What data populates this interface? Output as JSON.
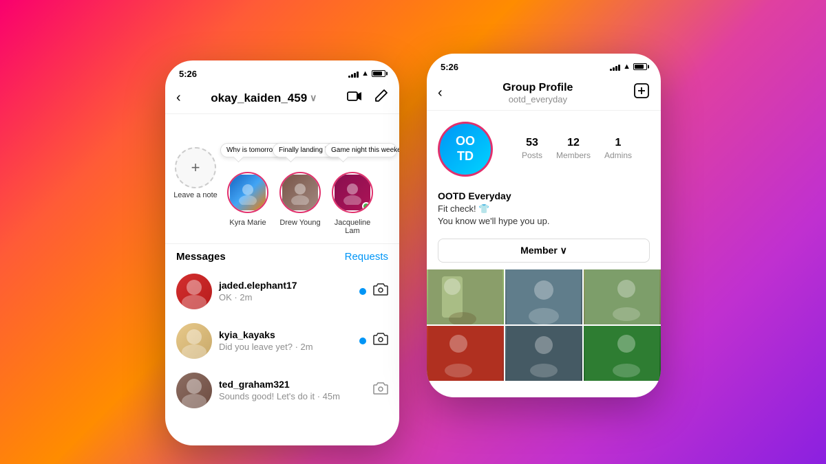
{
  "background": {
    "gradient": "linear-gradient(135deg, #f9006e, #ff5b37, #ff8c00, #e040a0, #c030d0, #8b20e0)"
  },
  "phone_left": {
    "status_bar": {
      "time": "5:26"
    },
    "header": {
      "back_label": "<",
      "username": "okay_kaiden_459",
      "chevron": "∨"
    },
    "stories": {
      "items": [
        {
          "name": "Leave a note",
          "type": "add",
          "label": "Leave a note"
        },
        {
          "name": "Kyra Marie",
          "note": "Why is tomorrow Monday!?😩",
          "label": "Kyra Marie"
        },
        {
          "name": "Drew Young",
          "note": "Finally landing in NYC! ❤️",
          "label": "Drew Young"
        },
        {
          "name": "Jacqueline Lam",
          "note": "Game night this weekend? 🎱",
          "label": "Jacqueline Lam",
          "online": true
        }
      ]
    },
    "messages": {
      "label": "Messages",
      "requests_label": "Requests",
      "items": [
        {
          "username": "jaded.elephant17",
          "preview": "OK · 2m",
          "unread": true
        },
        {
          "username": "kyia_kayaks",
          "preview": "Did you leave yet? · 2m",
          "unread": true
        },
        {
          "username": "ted_graham321",
          "preview": "Sounds good! Let's do it · 45m",
          "unread": false
        }
      ]
    }
  },
  "phone_right": {
    "status_bar": {
      "time": "5:26"
    },
    "header": {
      "back_label": "<",
      "title": "Group Profile",
      "subtitle": "ootd_everyday",
      "add_icon": "⊞"
    },
    "group": {
      "avatar_text": "OO\nTD",
      "name": "OOTD Everyday",
      "bio_line1": "Fit check! 👕",
      "bio_line2": "You know we'll hype you up.",
      "stats": {
        "posts": {
          "number": "53",
          "label": "Posts"
        },
        "members": {
          "number": "12",
          "label": "Members"
        },
        "admins": {
          "number": "1",
          "label": "Admins"
        }
      },
      "member_button": "Member ∨"
    },
    "photos": [
      {
        "id": 1,
        "color": "#8a9e6a"
      },
      {
        "id": 2,
        "color": "#607d8b"
      },
      {
        "id": 3,
        "color": "#7d8e6a"
      },
      {
        "id": 4,
        "color": "#b03020"
      },
      {
        "id": 5,
        "color": "#546e7a"
      },
      {
        "id": 6,
        "color": "#3a6e3a"
      }
    ]
  }
}
